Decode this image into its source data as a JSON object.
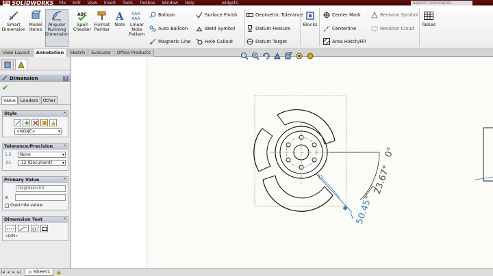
{
  "app": {
    "brand": "SOLIDWORKS",
    "brand_prefix": "DS",
    "doc_title": "widget1",
    "menus": [
      "File",
      "Edit",
      "View",
      "Insert",
      "Tools",
      "Toolbox",
      "Window",
      "Help"
    ],
    "search_placeholder": "Search Commands"
  },
  "ribbon": {
    "big_buttons": [
      {
        "label": "Smart Dimension",
        "icon": "smart-dimension-icon"
      },
      {
        "label": "Model Items",
        "icon": "model-items-icon"
      },
      {
        "label": "Angular Running Dimension",
        "icon": "angular-running-dimension-icon"
      },
      {
        "label": "Spell Checker",
        "icon": "spell-checker-icon"
      },
      {
        "label": "Format Painter",
        "icon": "format-painter-icon"
      },
      {
        "label": "Note",
        "icon": "note-icon"
      },
      {
        "label": "Linear Note Pattern",
        "icon": "linear-note-pattern-icon"
      },
      {
        "label": "Blocks",
        "icon": "blocks-icon"
      },
      {
        "label": "Tables",
        "icon": "tables-icon"
      }
    ],
    "col1": [
      "Balloon",
      "Auto Balloon",
      "Magnetic Line"
    ],
    "col2": [
      "Surface Finish",
      "Weld Symbol",
      "Hole Callout"
    ],
    "col3": [
      "Geometric Tolerance",
      "Datum Feature",
      "Datum Target"
    ],
    "col4": [
      "Center Mark",
      "Centerline",
      "Area Hatch/Fill"
    ],
    "col5": [
      "Revision Symbol",
      "Revision Cloud"
    ]
  },
  "tabs": [
    "View Layout",
    "Annotation",
    "Sketch",
    "Evaluate",
    "Office Products"
  ],
  "active_tab": "Annotation",
  "panel": {
    "title": "Dimension",
    "help": "?",
    "subtabs": [
      "Value",
      "Leaders",
      "Other"
    ],
    "style_group": "Style",
    "style_value": "<NONE>",
    "tolerance_group": "Tolerance/Precision",
    "tolerance_value": "None",
    "precision_value": ".12 (Document)",
    "primary_group": "Primary Value",
    "primary_name": "D4@Sketch3",
    "override_label": "Override value:",
    "dimtext_group": "Dimension Text",
    "dimtext_value": "<DIM>"
  },
  "drawing": {
    "angle_top": "0°",
    "angle_value": "23.67°",
    "angle_bottom": "50.45°"
  },
  "sheet": {
    "name": "Sheet1"
  },
  "colors": {
    "title_bar": "#5a0b0b",
    "dimension_blue": "#3f7fb8",
    "accent": "#aab2bf"
  }
}
